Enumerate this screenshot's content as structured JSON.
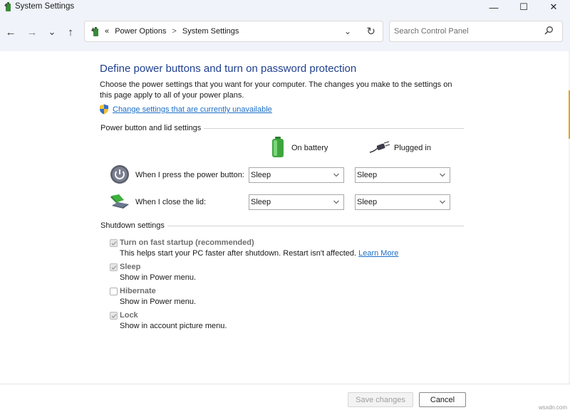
{
  "window": {
    "title": "System Settings",
    "controls": {
      "minimize": "—",
      "maximize": "☐",
      "close": "✕"
    }
  },
  "nav": {
    "back": "←",
    "forward": "→",
    "recent": "⌄",
    "up": "↑"
  },
  "address": {
    "overflow": "«",
    "crumbs": [
      "Power Options",
      "System Settings"
    ],
    "separator": ">",
    "dropdown": "⌄",
    "refresh": "↻"
  },
  "search": {
    "placeholder": "Search Control Panel"
  },
  "main": {
    "title": "Define power buttons and turn on password protection",
    "description": "Choose the power settings that you want for your computer. The changes you make to the settings on this page apply to all of your power plans.",
    "change_link": "Change settings that are currently unavailable"
  },
  "power_section": {
    "label": "Power button and lid settings",
    "columns": {
      "battery": "On battery",
      "plugged": "Plugged in"
    },
    "rows": [
      {
        "label": "When I press the power button:",
        "battery": "Sleep",
        "plugged": "Sleep"
      },
      {
        "label": "When I close the lid:",
        "battery": "Sleep",
        "plugged": "Sleep"
      }
    ]
  },
  "shutdown_section": {
    "label": "Shutdown settings",
    "items": [
      {
        "label": "Turn on fast startup (recommended)",
        "sub": "This helps start your PC faster after shutdown. Restart isn't affected.",
        "link": "Learn More",
        "checked": true
      },
      {
        "label": "Sleep",
        "sub": "Show in Power menu.",
        "checked": true
      },
      {
        "label": "Hibernate",
        "sub": "Show in Power menu.",
        "checked": false
      },
      {
        "label": "Lock",
        "sub": "Show in account picture menu.",
        "checked": true
      }
    ]
  },
  "footer": {
    "save": "Save changes",
    "cancel": "Cancel"
  },
  "watermark": "wsxdn.com",
  "colors": {
    "title_blue": "#1f3f8f",
    "link_blue": "#1c6fc7",
    "chrome_bg": "#f0f3f9"
  }
}
